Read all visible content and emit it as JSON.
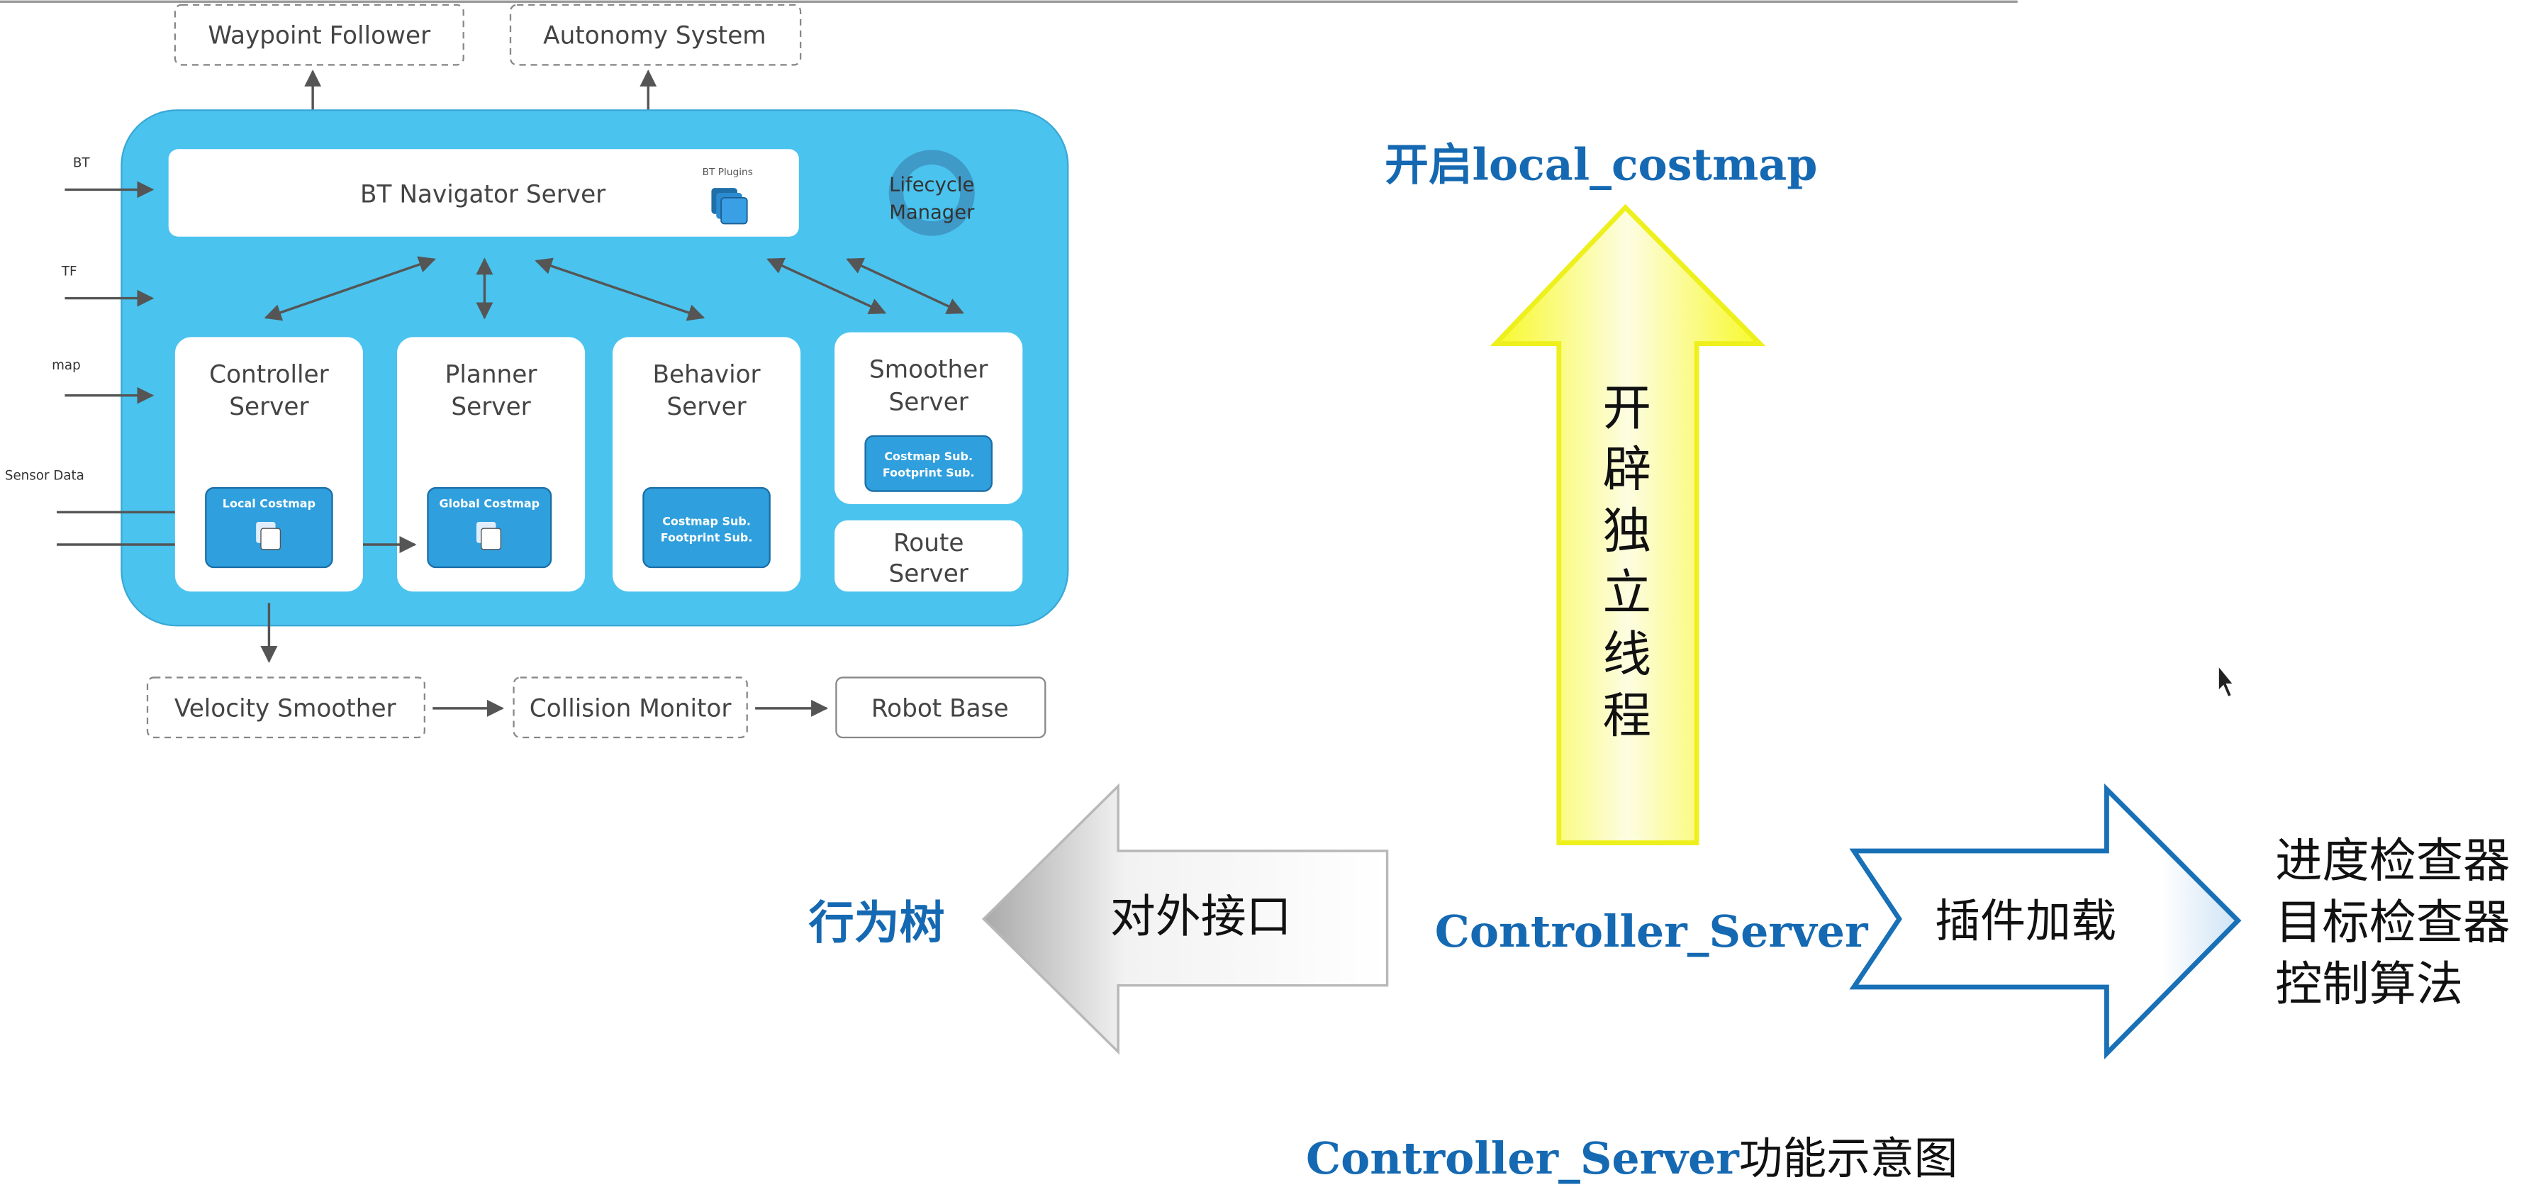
{
  "nav2": {
    "waypoint_follower": "Waypoint Follower",
    "autonomy_system": "Autonomy System",
    "bt_navigator": "BT Navigator Server",
    "bt_plugins": "BT Plugins",
    "lifecycle_line1": "Lifecycle",
    "lifecycle_line2": "Manager",
    "inputs": [
      "BT",
      "TF",
      "map",
      "Sensor Data"
    ],
    "controller_line1": "Controller",
    "controller_line2": "Server",
    "local_costmap": "Local Costmap",
    "planner_line1": "Planner",
    "planner_line2": "Server",
    "global_costmap": "Global Costmap",
    "behavior_line1": "Behavior",
    "behavior_line2": "Server",
    "behavior_sub1": "Costmap Sub.",
    "behavior_sub2": "Footprint Sub.",
    "smoother_line1": "Smoother",
    "smoother_line2": "Server",
    "smoother_sub1": "Costmap Sub.",
    "smoother_sub2": "Footprint Sub.",
    "route_line1": "Route",
    "route_line2": "Server",
    "velocity_smoother": "Velocity Smoother",
    "collision_monitor": "Collision Monitor",
    "robot_base": "Robot Base"
  },
  "annotation": {
    "top_label": "开启local_costmap",
    "up_arrow_chars": [
      "开",
      "辟",
      "独",
      "立",
      "线",
      "程"
    ],
    "left_label": "行为树",
    "left_arrow_text": "对外接口",
    "center_label": "Controller_Server",
    "right_arrow_text": "插件加载",
    "right_list": [
      "进度检查器",
      "目标检查器",
      "控制算法"
    ],
    "caption_part1": "Controller_Server",
    "caption_part2": "功能示意图"
  },
  "colors": {
    "nav_bg": "#4ac3ee",
    "costmap_box": "#2f9fdd",
    "label_blue": "#1569b2",
    "yellow_arrow": "#f8f92a",
    "blue_arrow_stroke": "#1870b6"
  }
}
